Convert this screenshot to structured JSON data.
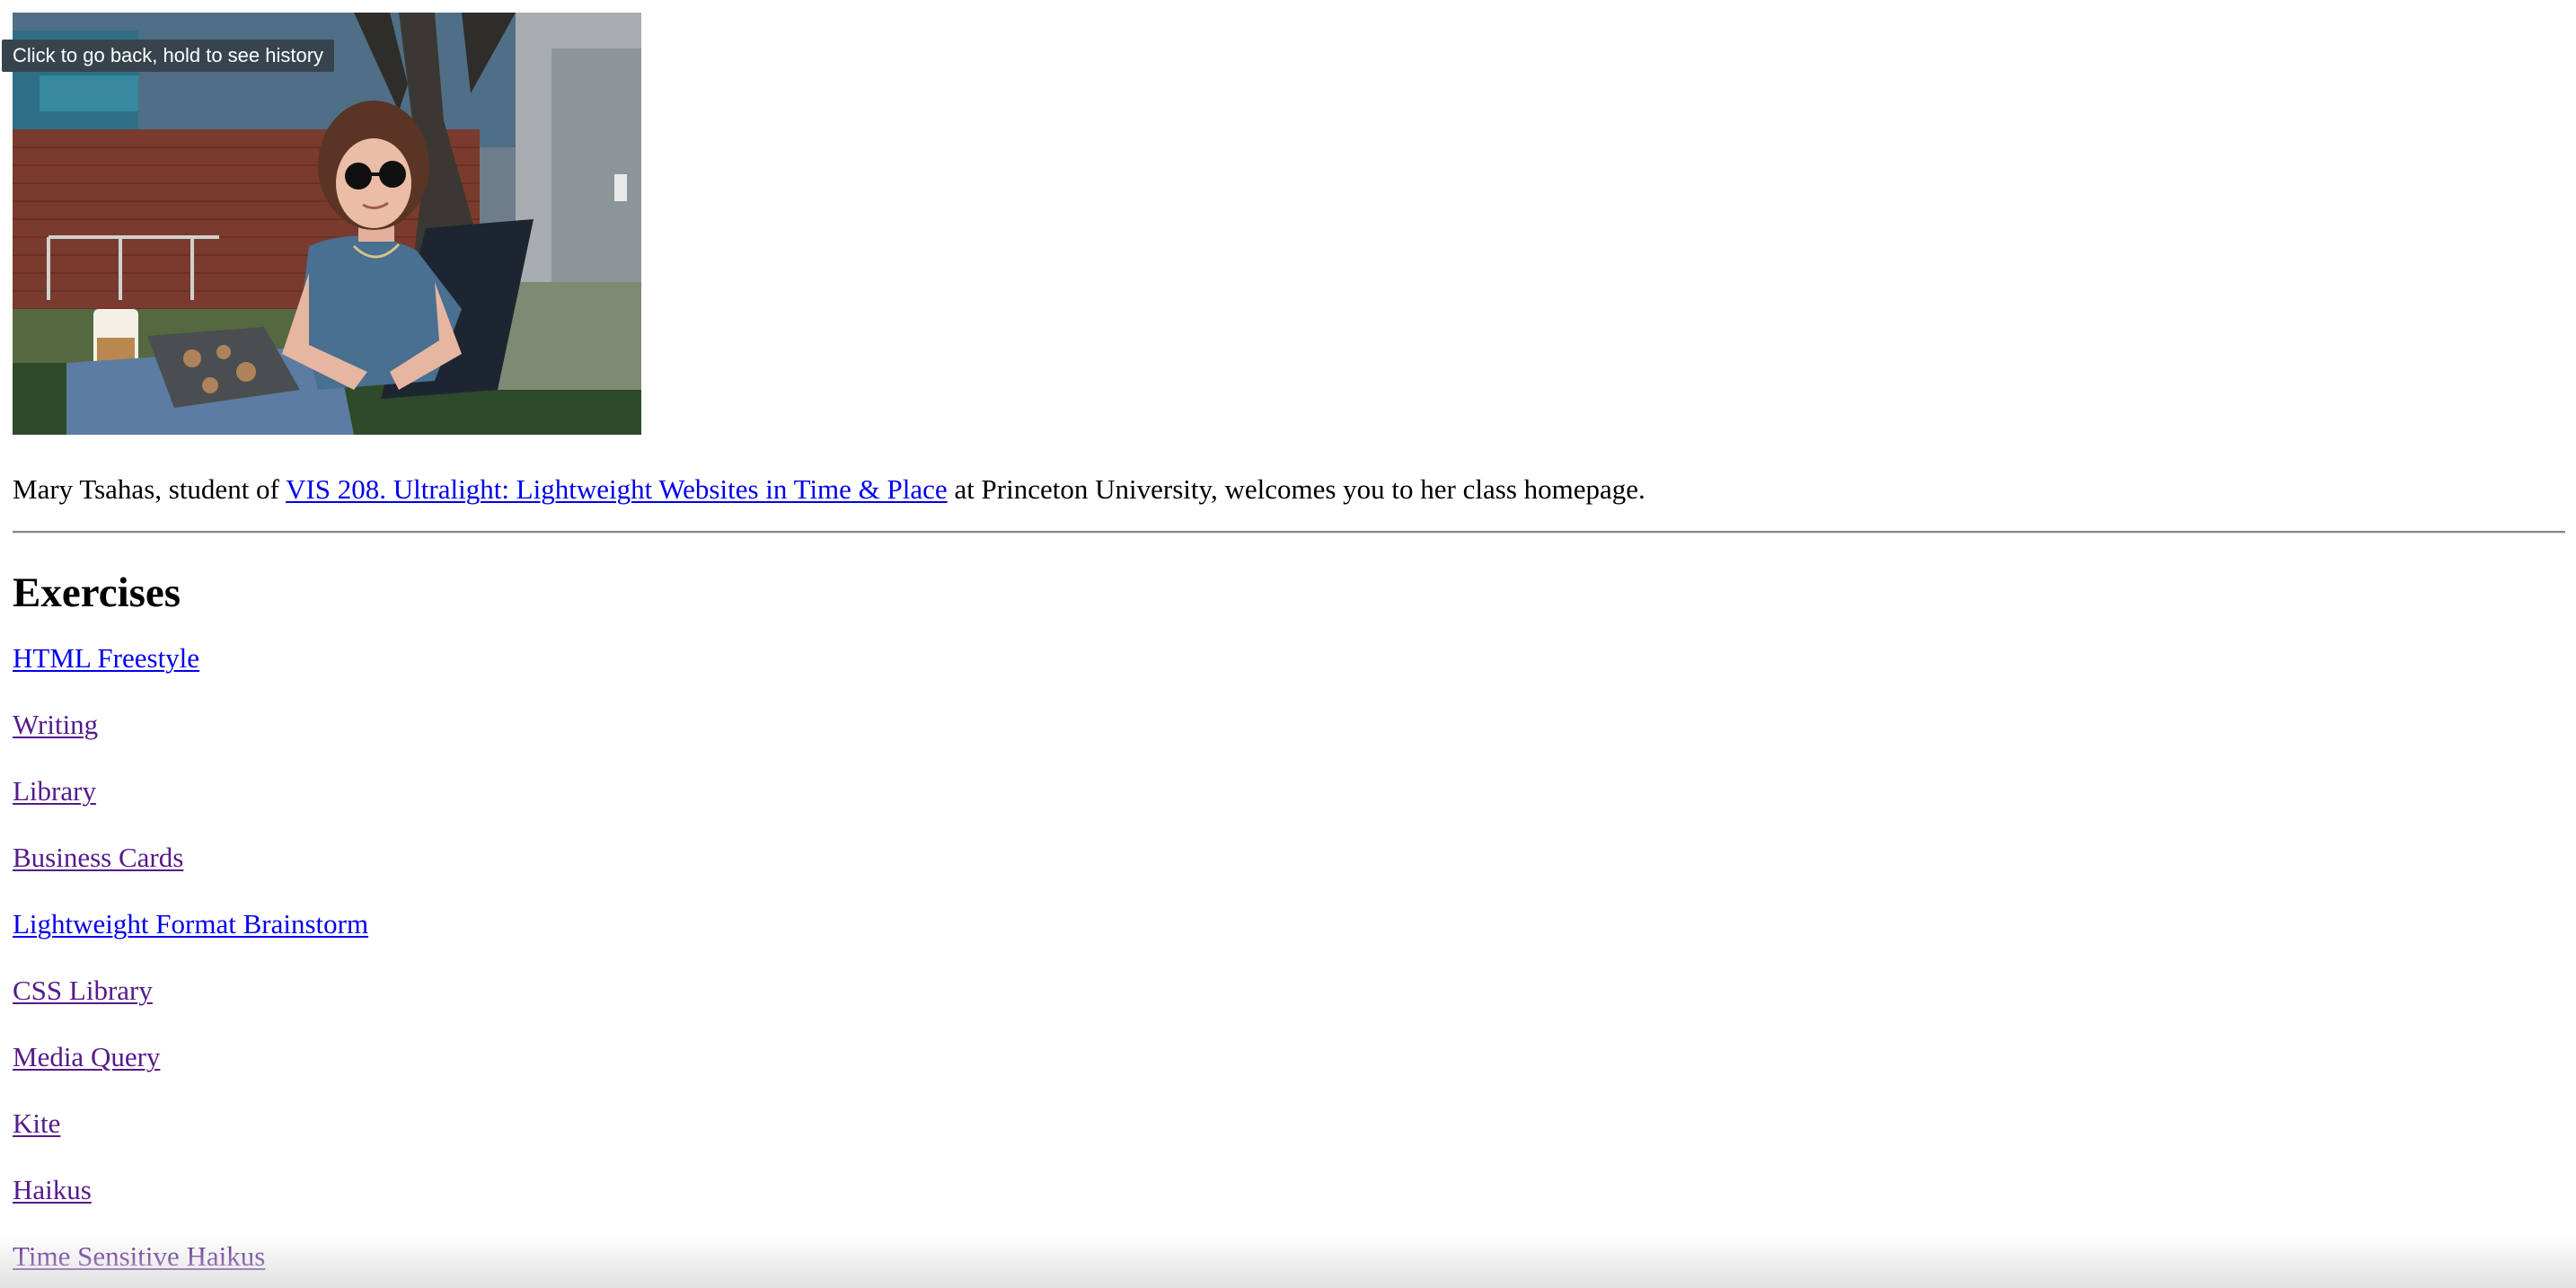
{
  "tooltip": "Click to go back, hold to see history",
  "intro": {
    "before": "Mary Tsahas, student of ",
    "course_link": "VIS 208. Ultralight: Lightweight Websites in Time & Place",
    "after": " at Princeton University, welcomes you to her class homepage."
  },
  "section_title": "Exercises",
  "exercises": [
    {
      "label": "HTML Freestyle",
      "visited": false
    },
    {
      "label": "Writing",
      "visited": true
    },
    {
      "label": "Library",
      "visited": true
    },
    {
      "label": "Business Cards",
      "visited": true
    },
    {
      "label": "Lightweight Format Brainstorm",
      "visited": false
    },
    {
      "label": "CSS Library",
      "visited": true
    },
    {
      "label": "Media Query",
      "visited": true
    },
    {
      "label": "Kite",
      "visited": true
    },
    {
      "label": "Haikus",
      "visited": true
    },
    {
      "label": "Time Sensitive Haikus",
      "visited": true
    }
  ],
  "colors": {
    "link": "#0000ee",
    "visited_link": "#551a8b",
    "tooltip_bg": "#38444d"
  }
}
